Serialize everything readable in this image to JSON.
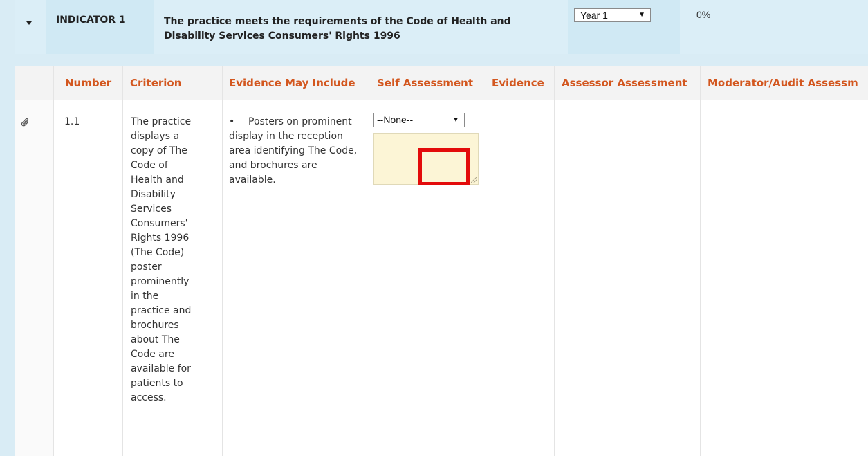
{
  "indicator": {
    "code": "INDICATOR 1",
    "title": "The practice meets the requirements of the Code of Health and Disability Services Consumers' Rights 1996",
    "year_selected": "Year 1",
    "percent": "0%"
  },
  "table": {
    "headers": [
      "Number",
      "Criterion",
      "Evidence May Include",
      "Self Assessment",
      "Evidence",
      "Assessor Assessment",
      "Moderator/Audit Assessm"
    ],
    "rows": [
      {
        "number": "1.1",
        "criterion": "The practice displays a copy of The Code of Health and Disability Services Consumers' Rights 1996 (The Code) poster prominently in the practice and brochures about The Code are available for patients to access.",
        "evidence_may_include_bullet": "•",
        "evidence_may_include": "Posters on prominent display in the reception area identifying The Code, and brochures are available.",
        "self_assessment_value": "--None--",
        "self_assessment_note": ""
      }
    ]
  },
  "icons": {
    "toggle": "caret-down-icon",
    "attachment": "paperclip-icon",
    "dropdown": "triangle-down-icon"
  },
  "colors": {
    "header_bg": "#d9ecf5",
    "column_header_text": "#d3571f",
    "highlight": "#e30b0b",
    "textarea_bg": "#fcf5d6"
  }
}
